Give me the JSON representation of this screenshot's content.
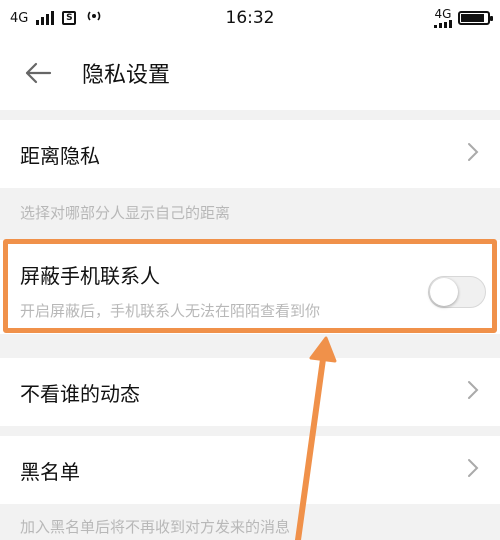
{
  "status_bar": {
    "network_left": "4G",
    "time": "16:32",
    "network_right": "4G",
    "battery_level": 0.9
  },
  "header": {
    "title": "隐私设置"
  },
  "items": {
    "distance_privacy": {
      "label": "距离隐私",
      "hint": "选择对哪部分人显示自己的距离"
    },
    "block_contacts": {
      "label": "屏蔽手机联系人",
      "description": "开启屏蔽后，手机联系人无法在陌陌查看到你",
      "enabled": false
    },
    "hide_moments": {
      "label": "不看谁的动态"
    },
    "blacklist": {
      "label": "黑名单",
      "hint": "加入黑名单后将不再收到对方发来的消息"
    }
  },
  "colors": {
    "annotation": "#f0914a",
    "page_background": "#f2f2f2",
    "hint_text": "#b8b8b8"
  },
  "icons": [
    "signal-icon",
    "sim-card-icon",
    "hotspot-icon",
    "battery-icon",
    "back-arrow-icon",
    "chevron-right-icon"
  ]
}
